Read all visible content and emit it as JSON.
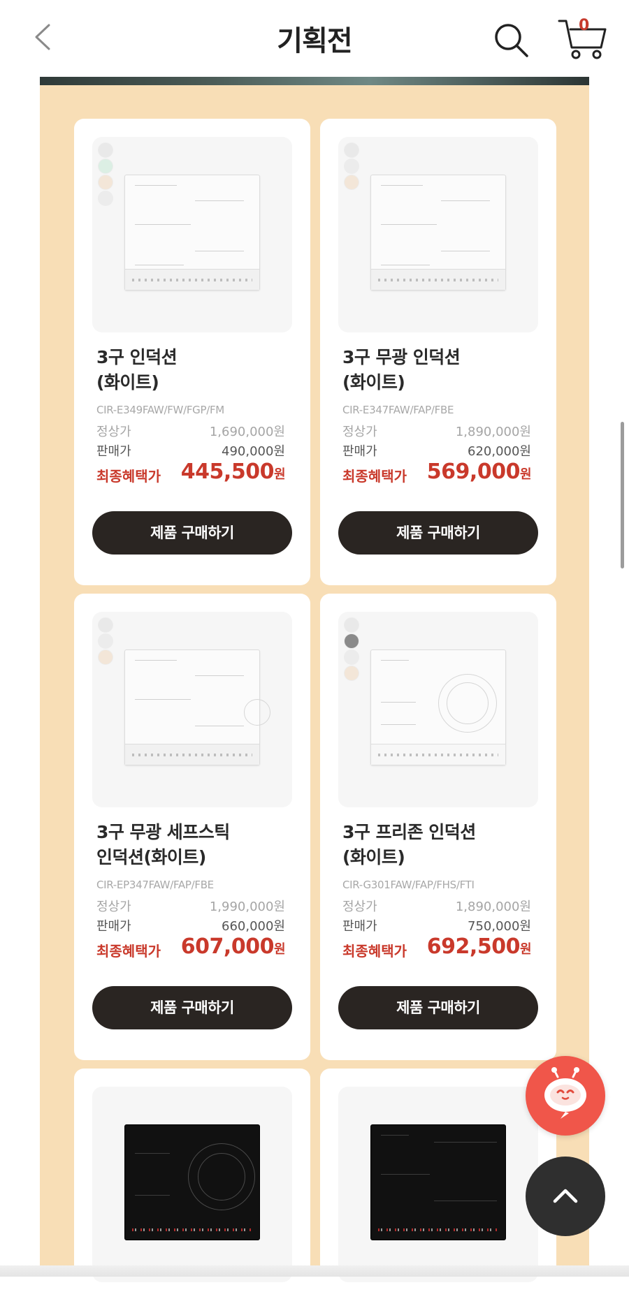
{
  "header": {
    "title": "기획전",
    "cart_count": "0"
  },
  "products": [
    {
      "name": "3구 인덕션\n(화이트)",
      "model": "CIR-E349FAW/FW/FGP/FM",
      "regular_label": "정상가",
      "regular_price": "1,690,000원",
      "sale_label": "판매가",
      "sale_price": "490,000원",
      "final_label": "최종혜택가",
      "final_price": "445,500",
      "final_unit": "원",
      "buy_label": "제품 구매하기",
      "swatch_colors": [
        "#e9e9e9",
        "#dcefe4",
        "#f3e6d8",
        "#ececec"
      ]
    },
    {
      "name": "3구 무광 인덕션\n(화이트)",
      "model": "CIR-E347FAW/FAP/FBE",
      "regular_label": "정상가",
      "regular_price": "1,890,000원",
      "sale_label": "판매가",
      "sale_price": "620,000원",
      "final_label": "최종혜택가",
      "final_price": "569,000",
      "final_unit": "원",
      "buy_label": "제품 구매하기",
      "swatch_colors": [
        "#e9e9e9",
        "#ececec",
        "#f3e6d8"
      ]
    },
    {
      "name": "3구 무광 세프스틱\n인덕션(화이트)",
      "model": "CIR-EP347FAW/FAP/FBE",
      "regular_label": "정상가",
      "regular_price": "1,990,000원",
      "sale_label": "판매가",
      "sale_price": "660,000원",
      "final_label": "최종혜택가",
      "final_price": "607,000",
      "final_unit": "원",
      "buy_label": "제품 구매하기",
      "swatch_colors": [
        "#e9e9e9",
        "#ececec",
        "#f3e6d8"
      ]
    },
    {
      "name": "3구 프리존 인덕션\n(화이트)",
      "model": "CIR-G301FAW/FAP/FHS/FTI",
      "regular_label": "정상가",
      "regular_price": "1,890,000원",
      "sale_label": "판매가",
      "sale_price": "750,000원",
      "final_label": "최종혜택가",
      "final_price": "692,500",
      "final_unit": "원",
      "buy_label": "제품 구매하기",
      "swatch_colors": [
        "#e9e9e9",
        "#8a8a8a",
        "#ececec",
        "#f3e6d8"
      ]
    }
  ],
  "icons": {
    "back": "chevron-left-icon",
    "search": "search-icon",
    "cart": "cart-icon",
    "chatbot": "chatbot-robot-icon",
    "scroll_top": "chevron-up-icon"
  },
  "colors": {
    "promo_background": "#f8deb6",
    "final_price": "#c9392b",
    "buy_button": "#2a2522",
    "chatbot": "#f0564a"
  }
}
